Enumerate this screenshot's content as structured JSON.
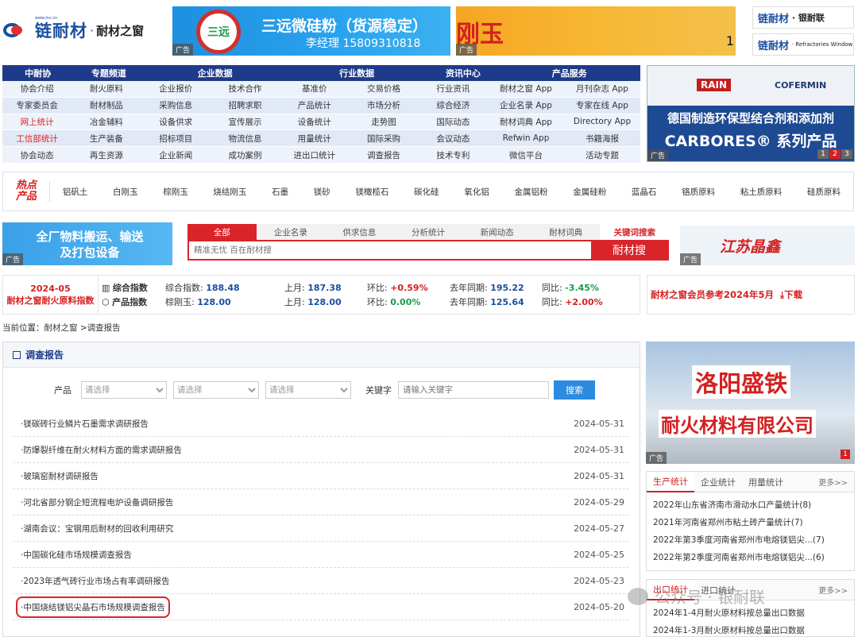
{
  "logo": {
    "brand": "链耐材",
    "dot": "·",
    "site": "耐材之窗",
    "small": "www.lnc.cn"
  },
  "ad_label": "广告",
  "ad1": {
    "circle": "三远",
    "line1": "三远微硅粉（货源稳定）",
    "line2": "李经理 15809310818"
  },
  "ad2": {
    "text": "刚玉",
    "num": "1"
  },
  "right_logos": [
    {
      "brand": "链耐材",
      "suffix": "· 银耐联"
    },
    {
      "brand": "链耐材",
      "suffix": "· Refractories Window"
    }
  ],
  "nav": {
    "headers": [
      "中耐协",
      "专题频道",
      "企业数据",
      "行业数据",
      "资讯中心",
      "产品服务"
    ],
    "rows": [
      [
        "协会介绍",
        "耐火原料",
        "企业报价",
        "技术合作",
        "基准价",
        "交易价格",
        "行业资讯",
        "耐材之窗 App",
        "月刊杂志 App",
        ""
      ],
      [
        "专家委员会",
        "耐材制品",
        "采购信息",
        "招聘求职",
        "产品统计",
        "市场分析",
        "综合经济",
        "企业名录 App",
        "专家在线 App",
        ""
      ],
      [
        "网上统计",
        "冶金辅料",
        "设备供求",
        "宣传展示",
        "设备统计",
        "走势图",
        "国际动态",
        "耐材词典 App",
        "Directory App",
        ""
      ],
      [
        "工信部统计",
        "生产装备",
        "招标项目",
        "物流信息",
        "用量统计",
        "国际采购",
        "会议动态",
        "Refwin App",
        "书籍海报",
        ""
      ],
      [
        "协会动态",
        "再生资源",
        "企业新闻",
        "成功案例",
        "进出口统计",
        "调查报告",
        "技术专利",
        "微信平台",
        "活动专题",
        ""
      ]
    ]
  },
  "rban": {
    "brand1": "RAIN",
    "brand2": "COFERMIN",
    "line1": "德国制造环保型结合剂和添加剂",
    "line2": "CARBORES® 系列产品",
    "pages": [
      "1",
      "2",
      "3"
    ]
  },
  "hot": {
    "label1": "热点",
    "label2": "产品",
    "items": [
      "铝矾土",
      "白刚玉",
      "棕刚玉",
      "烧结刚玉",
      "石墨",
      "镁砂",
      "镁橄榄石",
      "碳化硅",
      "氧化铝",
      "金属铝粉",
      "金属硅粉",
      "蓝晶石",
      "铬质原料",
      "粘土质原料",
      "硅质原料"
    ]
  },
  "ad3": {
    "text1": "全厂物料搬运、输送",
    "text2": "及打包设备"
  },
  "search": {
    "tabs": [
      "全部",
      "企业名录",
      "供求信息",
      "分析统计",
      "新闻动态",
      "耐材词典",
      "关键词搜索"
    ],
    "placeholder": "精准无忧 百在耐材搜",
    "button": "耐材搜"
  },
  "ad4": {
    "text": "江苏晶鑫"
  },
  "index": {
    "date": "2024-05",
    "name": "耐材之窗耐火原料指数",
    "r1": {
      "label": "综合指数",
      "name": "综合指数:",
      "value": "188.48",
      "last_label": "上月:",
      "last": "187.38",
      "mom_label": "环比:",
      "mom": "+0.59%",
      "yoy_label": "去年同期:",
      "yoy_val": "195.22",
      "tb_label": "同比:",
      "tb": "-3.45%"
    },
    "r2": {
      "label": "产品指数",
      "name": "棕刚玉:",
      "value": "128.00",
      "last_label": "上月:",
      "last": "128.00",
      "mom_label": "环比:",
      "mom": "0.00%",
      "yoy_label": "去年同期:",
      "yoy_val": "125.64",
      "tb_label": "同比:",
      "tb": "+2.00%"
    }
  },
  "report": {
    "text": "耐材之窗会员参考2024年5月",
    "download": "下载"
  },
  "crumb": "当前位置：耐材之窗 >调查报告",
  "main": {
    "title": "调查报告",
    "filter_label": "产品",
    "select": "请选择",
    "kw_label": "关键字",
    "kw_placeholder": "请输入关键字",
    "search_btn": "搜索",
    "items": [
      {
        "t": "·镁碳砖行业鳞片石墨需求调研报告",
        "d": "2024-05-31"
      },
      {
        "t": "·防爆裂纤维在耐火材料方面的需求调研报告",
        "d": "2024-05-31"
      },
      {
        "t": "·玻璃窑耐材调研报告",
        "d": "2024-05-31"
      },
      {
        "t": "·河北省部分钢企短流程电炉设备调研报告",
        "d": "2024-05-29"
      },
      {
        "t": "·湖南会议：宝钢用后耐材的回收利用研究",
        "d": "2024-05-27"
      },
      {
        "t": "·中国碳化硅市场规模调查报告",
        "d": "2024-05-25"
      },
      {
        "t": "·2023年透气砖行业市场占有率调研报告",
        "d": "2024-05-23"
      },
      {
        "t": "·中国烧结镁铝尖晶石市场规模调查报告",
        "d": "2024-05-20"
      }
    ]
  },
  "ad5": {
    "line1": "洛阳盛铁",
    "line2": "耐火材料有限公司",
    "page": "1"
  },
  "stats1": {
    "tabs": [
      "生产统计",
      "企业统计",
      "用量统计",
      "更多>>"
    ],
    "items": [
      "2022年山东省济南市滑动水口产量统计(8)",
      "2021年河南省郑州市粘土砖产量统计(7)",
      "2022年第3季度河南省郑州市电熔镁铝尖...(7)",
      "2022年第2季度河南省郑州市电熔镁铝尖...(6)"
    ]
  },
  "stats2": {
    "tabs": [
      "出口统计",
      "进口统计",
      "更多>>"
    ],
    "items": [
      "2024年1-4月耐火原材料按总量出口数据",
      "2024年1-3月耐火原材料按总量出口数据"
    ]
  },
  "watermark": "公众号 · 银耐联"
}
